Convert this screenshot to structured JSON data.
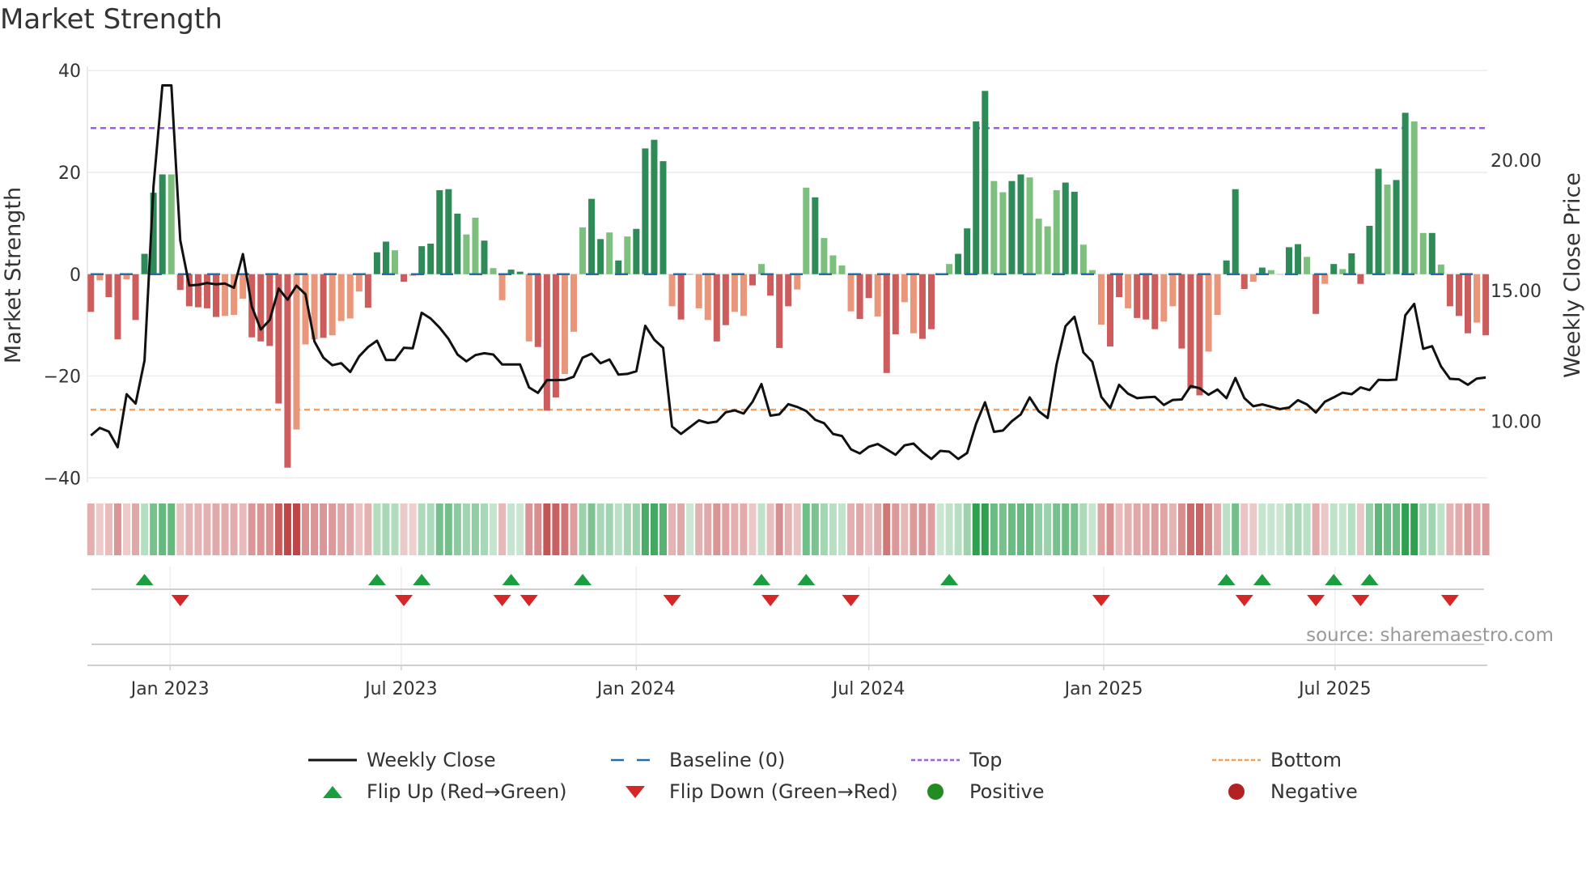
{
  "title": "Market Strength",
  "source": "source: sharemaestro.com",
  "chart_data": {
    "type": "bar",
    "title": "Market Strength",
    "ylabel": "Market Strength",
    "y2label": "Weekly Close Price",
    "ylim": [
      -40,
      40
    ],
    "y2lim": [
      7.5,
      23.5
    ],
    "yticks": [
      "40",
      "20",
      "0",
      "−20",
      "−40"
    ],
    "ytick_values": [
      40,
      20,
      0,
      -20,
      -40
    ],
    "y2ticks": [
      "20.00",
      "15.00",
      "10.00"
    ],
    "y2tick_values": [
      20,
      15,
      10
    ],
    "xticks": [
      "Jan 2023",
      "Jul 2023",
      "Jan 2024",
      "Jul 2024",
      "Jan 2025",
      "Jul 2025"
    ],
    "xtick_dates": [
      "2023-01-01",
      "2023-07-01",
      "2024-01-01",
      "2024-07-01",
      "2025-01-01",
      "2025-07-01"
    ],
    "start_date": "2022-10-31",
    "frequency": "weekly",
    "top_level": 28.7,
    "bottom_level": -26.6,
    "baseline": 0,
    "strength": [
      -7.4,
      -1.2,
      -4.5,
      -12.8,
      -1,
      -9,
      4,
      16,
      19.6,
      19.6,
      -3.1,
      -6.3,
      -6.5,
      -6.7,
      -8.4,
      -8.2,
      -8,
      -4.8,
      -12.4,
      -13.2,
      -14.1,
      -25.4,
      -38,
      -30.5,
      -13.8,
      -12.8,
      -12.5,
      -12,
      -9.2,
      -8.7,
      -3.4,
      -6.6,
      4.3,
      6.4,
      4.7,
      -1.5,
      -0.3,
      5.5,
      6,
      16.5,
      16.7,
      11.9,
      7.8,
      11.1,
      6.6,
      1.2,
      -5.1,
      0.9,
      0.5,
      -13.2,
      -14.3,
      -26.8,
      -24.2,
      -19.6,
      -11.3,
      9.2,
      14.8,
      6.9,
      8.2,
      2.7,
      7.4,
      8.9,
      24.7,
      26.4,
      22.2,
      -6.3,
      -8.9,
      0,
      -6.7,
      -9,
      -13.2,
      -10,
      -7.4,
      -8.2,
      -2.2,
      2,
      -4.2,
      -14.5,
      -6.3,
      -3,
      17,
      15.1,
      7.1,
      3.7,
      1.7,
      -7.3,
      -8.8,
      -4.7,
      -8.3,
      -19.4,
      -11.8,
      -5.5,
      -11.6,
      -12.7,
      -10.8,
      0,
      2,
      4,
      9,
      30,
      36,
      18.3,
      16.1,
      18.3,
      19.6,
      19,
      10.9,
      9.4,
      16.5,
      18,
      16.2,
      5.8,
      0.8,
      -9.9,
      -14.2,
      -4.5,
      -6.7,
      -8.6,
      -8.9,
      -10.8,
      -9.3,
      -6.3,
      -14.6,
      -22.5,
      -23.8,
      -15.2,
      -8,
      2.7,
      16.7,
      -2.9,
      -1.5,
      1.3,
      0.8,
      0,
      5.3,
      5.9,
      3.4,
      -7.8,
      -1.9,
      2,
      1,
      4.1,
      -1.9,
      9.5,
      20.7,
      17.6,
      18.5,
      31.7,
      30,
      8.1,
      8.1,
      1.9,
      -6.3,
      -8.2,
      -11.6,
      -9.5,
      -12
    ],
    "shade": "dlddlddddldddddllldddddllldlllldddldldddddlldllddldddlllddldlddddlddllddlldldddlldllllddlddllddllddddllddllllddlllddldddlldddlldddldllddldldlddddlddlldldddld",
    "close": [
      9.45,
      9.74,
      9.6,
      9.0,
      11.03,
      10.67,
      12.32,
      18.99,
      22.86,
      22.86,
      16.92,
      15.2,
      15.22,
      15.29,
      15.24,
      15.27,
      15.11,
      16.4,
      14.39,
      13.51,
      13.87,
      15.08,
      14.65,
      15.19,
      14.86,
      13.05,
      12.43,
      12.14,
      12.22,
      11.88,
      12.48,
      12.84,
      13.08,
      12.34,
      12.34,
      12.81,
      12.79,
      14.15,
      13.93,
      13.58,
      13.15,
      12.55,
      12.29,
      12.53,
      12.6,
      12.55,
      12.17,
      12.17,
      12.17,
      11.29,
      11.08,
      11.57,
      11.57,
      11.58,
      11.7,
      12.43,
      12.58,
      12.22,
      12.36,
      11.78,
      11.81,
      11.91,
      13.65,
      13.12,
      12.81,
      9.79,
      9.51,
      9.77,
      10.03,
      9.93,
      9.98,
      10.34,
      10.41,
      10.29,
      10.74,
      11.42,
      10.21,
      10.26,
      10.65,
      10.54,
      10.39,
      10.05,
      9.92,
      9.51,
      9.43,
      8.92,
      8.76,
      9.02,
      9.12,
      8.92,
      8.71,
      9.07,
      9.14,
      8.81,
      8.55,
      8.86,
      8.83,
      8.55,
      8.78,
      9.9,
      10.72,
      9.59,
      9.64,
      10.0,
      10.26,
      10.91,
      10.38,
      10.12,
      12.17,
      13.64,
      14.0,
      12.63,
      12.27,
      10.93,
      10.5,
      11.39,
      11.05,
      10.88,
      10.91,
      10.93,
      10.62,
      10.81,
      10.83,
      11.34,
      11.26,
      11.01,
      11.21,
      10.88,
      11.65,
      10.88,
      10.57,
      10.64,
      10.55,
      10.46,
      10.52,
      10.8,
      10.64,
      10.33,
      10.74,
      10.91,
      11.09,
      11.03,
      11.29,
      11.19,
      11.58,
      11.57,
      11.59,
      14.05,
      14.49,
      12.77,
      12.87,
      12.09,
      11.62,
      11.6,
      11.39,
      11.63,
      11.67
    ],
    "flip_up_weeks": [
      6,
      32,
      37,
      47,
      55,
      75,
      80,
      96,
      127,
      131,
      139,
      143
    ],
    "flip_down_weeks": [
      10,
      35,
      46,
      49,
      65,
      76,
      85,
      113,
      129,
      137,
      142,
      152
    ],
    "legend_placement": "bottom",
    "legend": [
      {
        "label": "Weekly Close",
        "kind": "line"
      },
      {
        "label": "Baseline (0)",
        "kind": "baseline"
      },
      {
        "label": "Top",
        "kind": "top"
      },
      {
        "label": "Bottom",
        "kind": "bottom"
      },
      {
        "label": "Flip Up (Red→Green)",
        "kind": "up"
      },
      {
        "label": "Flip Down (Green→Red)",
        "kind": "down"
      },
      {
        "label": "Positive",
        "kind": "pos"
      },
      {
        "label": "Negative",
        "kind": "neg"
      }
    ]
  },
  "colors": {
    "pos_strong": "#2e8b57",
    "pos_weak": "#7dbf7d",
    "neg_strong": "#cd5c5c",
    "neg_weak": "#e9967a",
    "close": "#111111",
    "baseline": "#1f6fa8",
    "top": "#9b5de5",
    "bottom": "#f0a060",
    "flip_up": "#1a9e3f",
    "flip_down": "#d62728",
    "positive": "#228b22",
    "negative": "#b22222"
  }
}
